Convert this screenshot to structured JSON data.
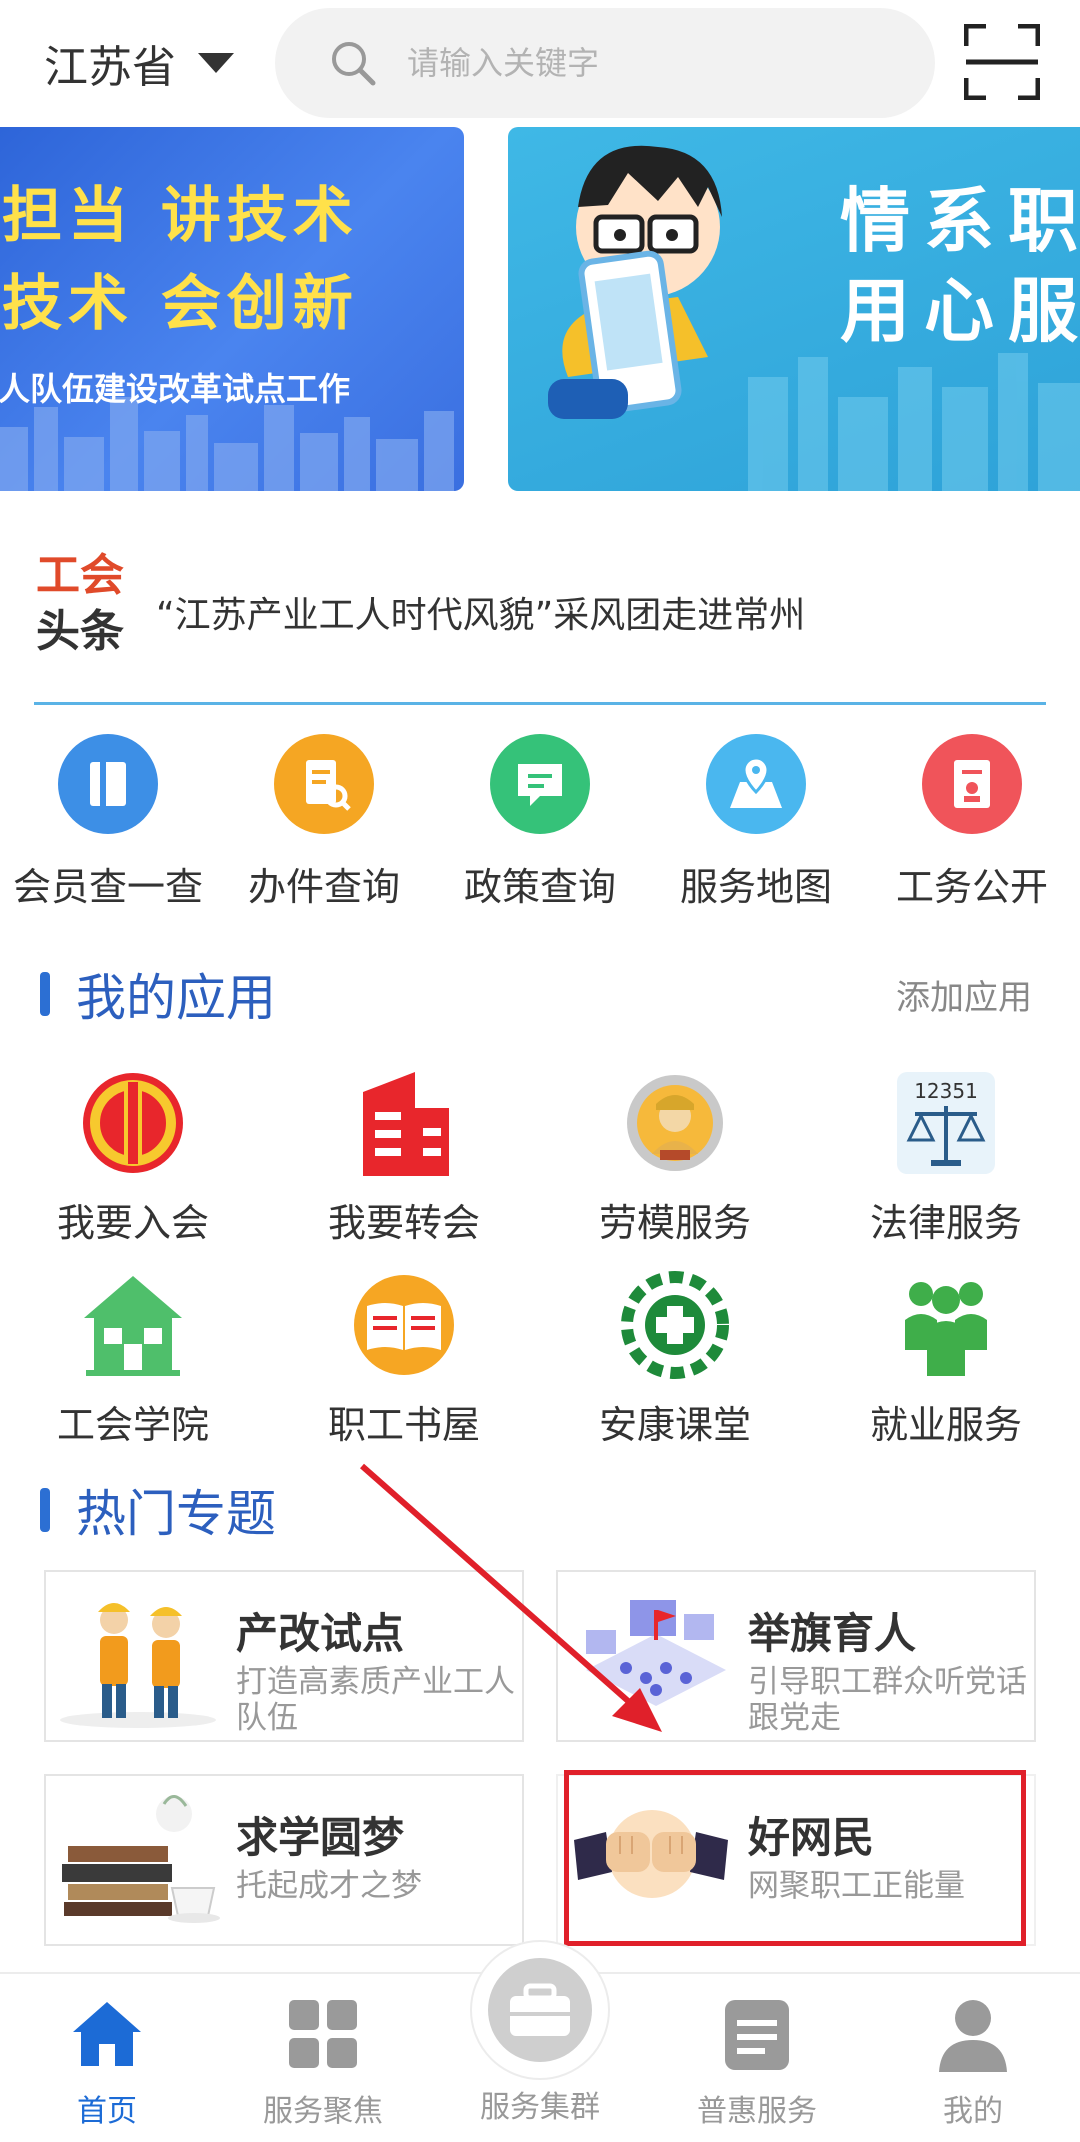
{
  "header": {
    "region": "江苏省",
    "search_placeholder": "请输入关键字"
  },
  "banners": {
    "left_lines": [
      "担当  讲技术",
      "技术  会创新"
    ],
    "left_sub": "人队伍建设改革试点工作",
    "right_lines": [
      "情系职",
      "用心服"
    ]
  },
  "headline": {
    "logo_top": "工会",
    "logo_bottom": "头条",
    "text": "“江苏产业工人时代风貌”采风团走进常州"
  },
  "quick_services": [
    {
      "label": "会员查一查",
      "color": "#3d8fe6"
    },
    {
      "label": "办件查询",
      "color": "#f5a623"
    },
    {
      "label": "政策查询",
      "color": "#35c279"
    },
    {
      "label": "服务地图",
      "color": "#4ab7ef"
    },
    {
      "label": "工务公开",
      "color": "#f0545a"
    }
  ],
  "my_apps": {
    "title": "我的应用",
    "add_label": "添加应用",
    "items": [
      {
        "label": "我要入会"
      },
      {
        "label": "我要转会"
      },
      {
        "label": "劳模服务"
      },
      {
        "label": "法律服务",
        "badge": "12351"
      },
      {
        "label": "工会学院"
      },
      {
        "label": "职工书屋"
      },
      {
        "label": "安康课堂"
      },
      {
        "label": "就业服务"
      }
    ]
  },
  "hot_topics": {
    "title": "热门专题",
    "items": [
      {
        "title": "产改试点",
        "subtitle": "打造高素质产业工人队伍"
      },
      {
        "title": "举旗育人",
        "subtitle": "引导职工群众听党话跟党走"
      },
      {
        "title": "求学圆梦",
        "subtitle": "托起成才之梦"
      },
      {
        "title": "好网民",
        "subtitle": "网聚职工正能量"
      }
    ]
  },
  "bottom_nav": [
    {
      "label": "首页",
      "active": true
    },
    {
      "label": "服务聚焦",
      "active": false
    },
    {
      "label": "服务集群",
      "active": false
    },
    {
      "label": "普惠服务",
      "active": false
    },
    {
      "label": "我的",
      "active": false
    }
  ],
  "colors": {
    "accent_blue": "#2c5fbe",
    "nav_active": "#1c6bd6",
    "highlight_red": "#e0202a"
  }
}
